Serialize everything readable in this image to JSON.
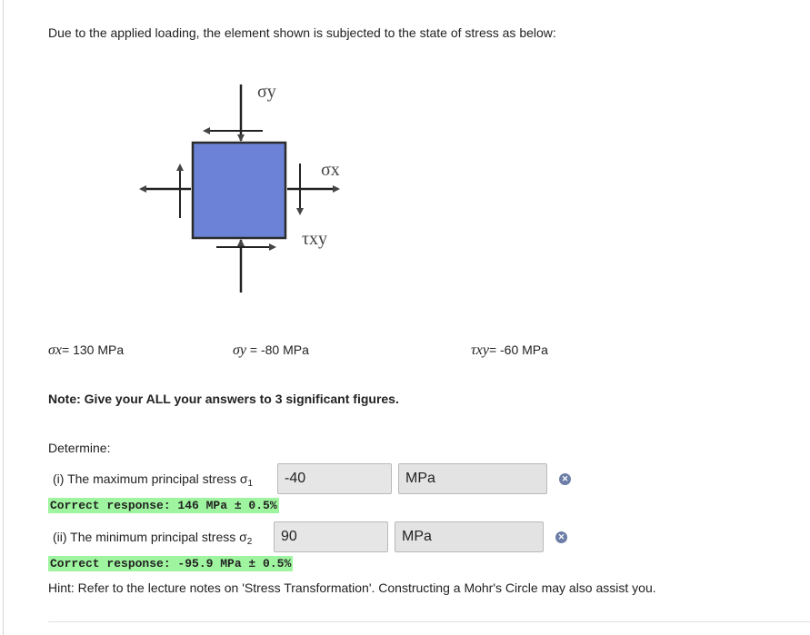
{
  "problem": {
    "intro": "Due to the applied loading, the element shown is subjected to the state of stress as below:",
    "diagram": {
      "label_sigma_y": "σy",
      "label_sigma_x": "σx",
      "label_tau_xy": "τxy",
      "colors": {
        "element_fill": "#6b82d6",
        "element_stroke": "#2b2b2b"
      }
    },
    "given": [
      {
        "symbol": "σx",
        "eq": "= ",
        "value": "130 MPa"
      },
      {
        "symbol": "σy",
        "eq": " = ",
        "value": "-80 MPa"
      },
      {
        "symbol": "τxy",
        "eq": "= ",
        "value": "-60 MPa"
      }
    ],
    "note": "Note: Give your ALL your answers to 3 significant figures.",
    "determine": "Determine:",
    "questions": [
      {
        "label": "(i) The maximum principal stress σ",
        "subscript": "1",
        "answer_value": "-40",
        "unit": "MPa",
        "status_icon": "incorrect-x-icon",
        "correct_response": "Correct response: 146 MPa ± 0.5%"
      },
      {
        "label": "(ii) The minimum principal stress σ",
        "subscript": "2",
        "answer_value": "90",
        "unit": "MPa",
        "status_icon": "incorrect-x-icon",
        "correct_response": "Correct response: -95.9 MPa ± 0.5%"
      }
    ],
    "hint": "Hint: Refer to the lecture notes on 'Stress Transformation'. Constructing a Mohr's Circle may also assist you."
  },
  "colors": {
    "correct_bg": "#9ff59f",
    "field_bg": "#e6e6e6",
    "x_icon": "#6c7ea8"
  }
}
